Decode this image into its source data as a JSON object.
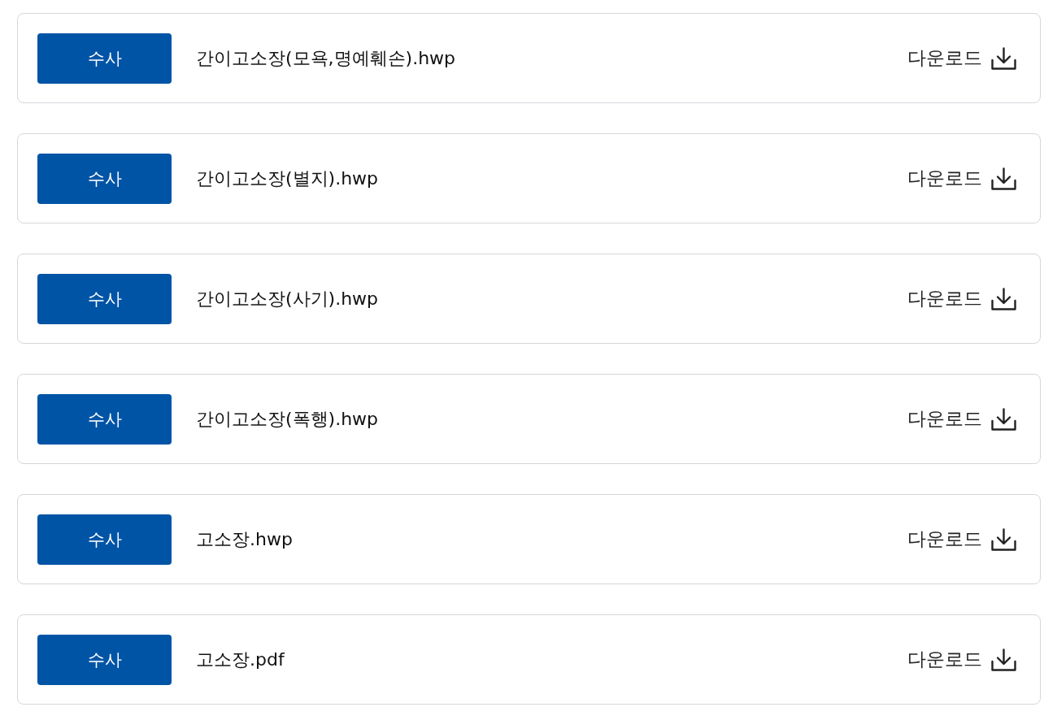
{
  "files": [
    {
      "category": "수사",
      "name": "간이고소장(모욕,명예훼손).hwp",
      "action": "다운로드"
    },
    {
      "category": "수사",
      "name": "간이고소장(별지).hwp",
      "action": "다운로드"
    },
    {
      "category": "수사",
      "name": "간이고소장(사기).hwp",
      "action": "다운로드"
    },
    {
      "category": "수사",
      "name": "간이고소장(폭행).hwp",
      "action": "다운로드"
    },
    {
      "category": "수사",
      "name": "고소장.hwp",
      "action": "다운로드"
    },
    {
      "category": "수사",
      "name": "고소장.pdf",
      "action": "다운로드"
    }
  ]
}
